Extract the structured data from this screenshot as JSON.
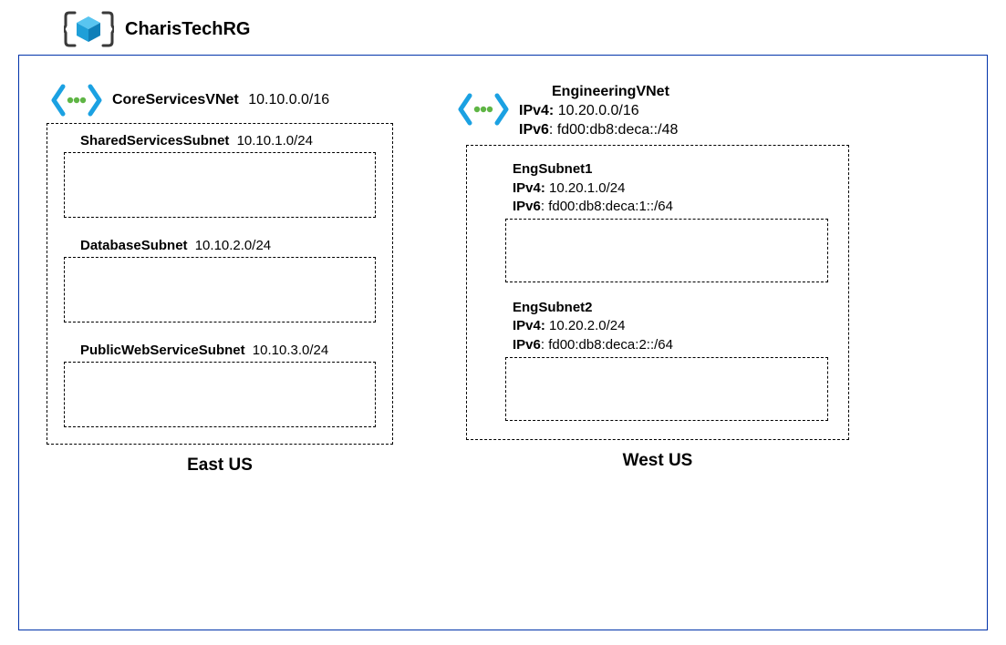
{
  "resource_group": {
    "name": "CharisTechRG"
  },
  "vnets": {
    "core": {
      "name": "CoreServicesVNet",
      "cidr": "10.10.0.0/16",
      "region": "East US",
      "subnets": {
        "shared": {
          "name": "SharedServicesSubnet",
          "cidr": "10.10.1.0/24"
        },
        "db": {
          "name": "DatabaseSubnet",
          "cidr": "10.10.2.0/24"
        },
        "web": {
          "name": "PublicWebServiceSubnet",
          "cidr": "10.10.3.0/24"
        }
      }
    },
    "eng": {
      "name": "EngineeringVNet",
      "ipv4_label": "IPv4:",
      "ipv4": "10.20.0.0/16",
      "ipv6_label": "IPv6",
      "ipv6": ": fd00:db8:deca::/48",
      "region": "West US",
      "subnets": {
        "s1": {
          "name": "EngSubnet1",
          "ipv4_label": "IPv4:",
          "ipv4": "10.20.1.0/24",
          "ipv6_label": "IPv6",
          "ipv6": ": fd00:db8:deca:1::/64"
        },
        "s2": {
          "name": "EngSubnet2",
          "ipv4_label": "IPv4:",
          "ipv4": "10.20.2.0/24",
          "ipv6_label": "IPv6",
          "ipv6": ": fd00:db8:deca:2::/64"
        }
      }
    }
  }
}
